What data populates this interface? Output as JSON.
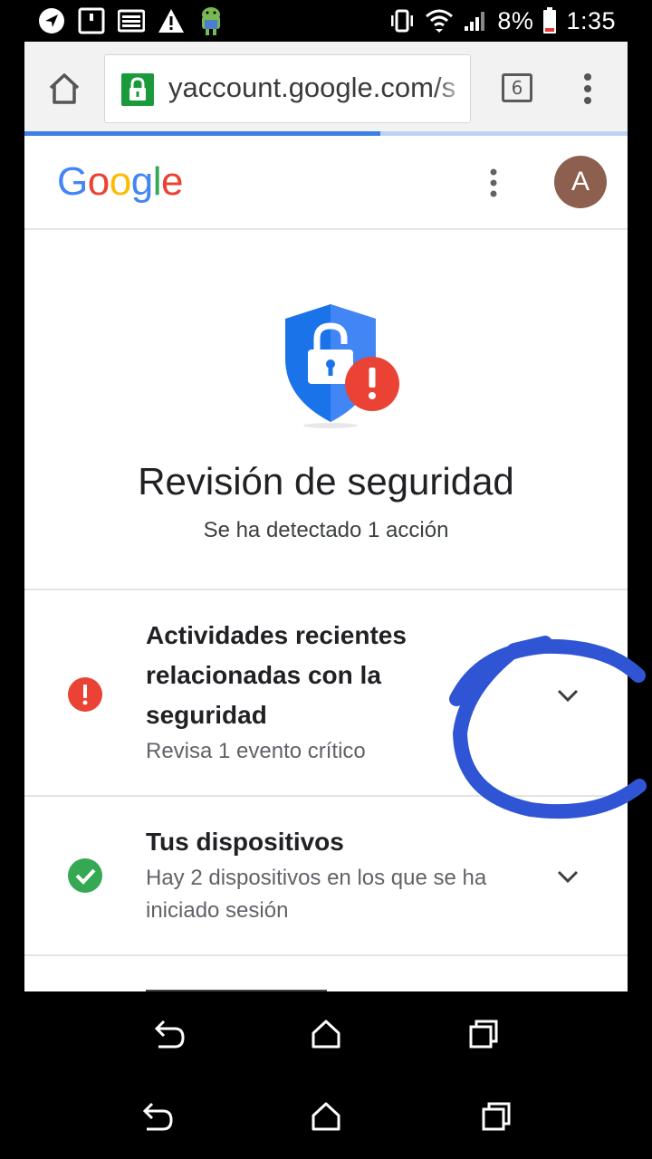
{
  "status_bar": {
    "battery_percent": "8%",
    "time": "1:35",
    "icons": [
      "navigation-icon",
      "notification-icon",
      "image-icon",
      "warning-icon",
      "android-icon",
      "vibrate-icon",
      "wifi-icon",
      "signal-icon",
      "battery-icon"
    ]
  },
  "browser": {
    "url": "yaccount.google.com/s",
    "tab_count": "6",
    "progress_fraction": 0.59,
    "colors": {
      "lock_badge": "#1a9a3a",
      "progress": "#3f7fe5"
    }
  },
  "header": {
    "logo_text": "Google",
    "avatar_letter": "A",
    "colors": {
      "g_blue": "#4285f4",
      "g_red": "#ea4335",
      "g_yellow": "#fbbc05",
      "g_green": "#34a853",
      "avatar": "#8d5f4e"
    }
  },
  "hero": {
    "title": "Revisión de seguridad",
    "subtitle": "Se ha detectado 1 acción",
    "icon": "shield-lock-alert-icon"
  },
  "items": [
    {
      "title": "Actividades recientes relacionadas con la seguridad",
      "description": "Revisa 1 evento crítico",
      "status": "critical",
      "status_icon": "alert-icon"
    },
    {
      "title": "Tus dispositivos",
      "description": "Hay 2 dispositivos en los que se ha iniciado sesión",
      "status": "ok",
      "status_icon": "check-icon"
    }
  ],
  "annotation": {
    "color": "#2f55d4"
  }
}
